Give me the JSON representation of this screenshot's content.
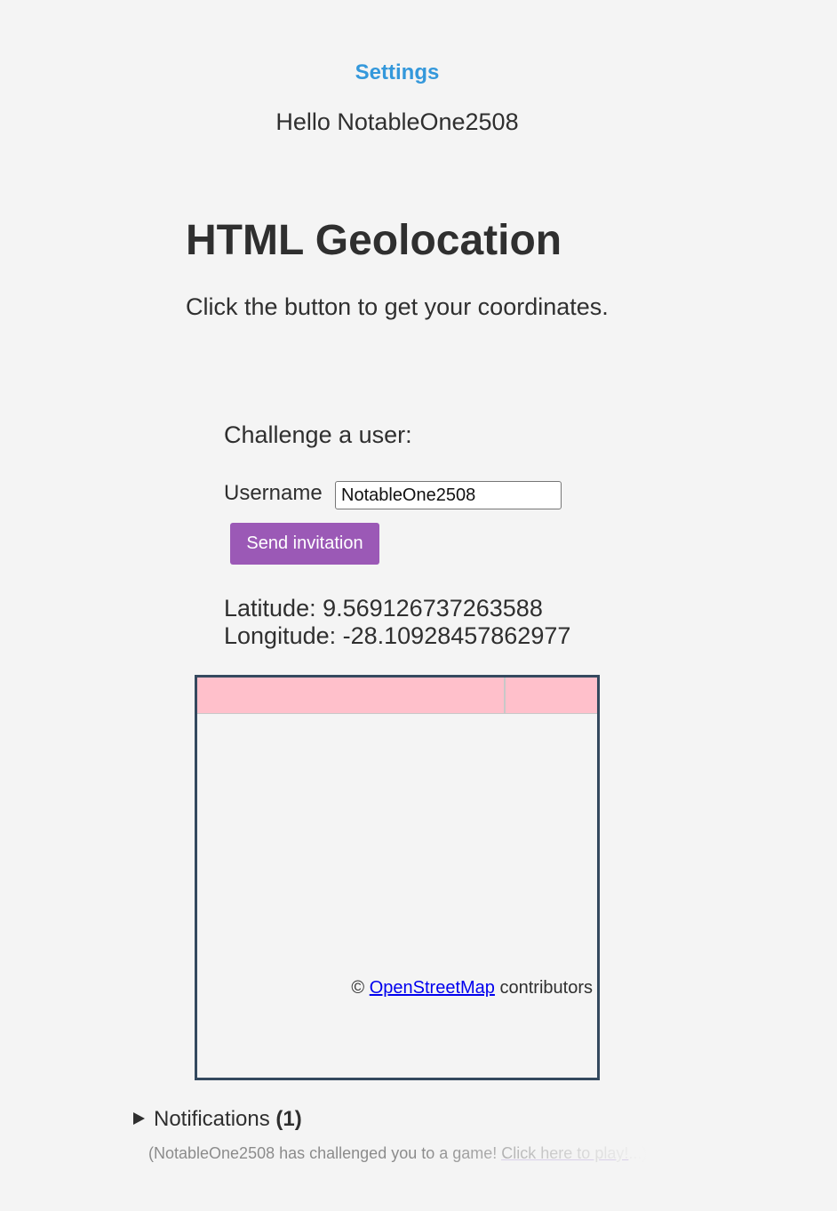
{
  "header": {
    "settings_label": "Settings",
    "greeting": "Hello NotableOne2508"
  },
  "main": {
    "title": "HTML Geolocation",
    "instructions": "Click the button to get your coordinates."
  },
  "challenge": {
    "heading": "Challenge a user:",
    "username_label": "Username",
    "username_value": "NotableOne2508",
    "send_label": "Send invitation"
  },
  "location": {
    "latitude_text": "Latitude: 9.569126737263588",
    "longitude_text": "Longitude: -28.10928457862977"
  },
  "map": {
    "attribution_prefix": "©",
    "attribution_link": "OpenStreetMap",
    "attribution_suffix": "contributors",
    "tile_color": "#ffc0cb"
  },
  "notifications": {
    "label": "Notifications",
    "count": "(1)",
    "items": [
      {
        "text": "(NotableOne2508 has challenged you to a game! ",
        "link": "Click here to play!",
        "ellipsis": "...)"
      }
    ]
  },
  "colors": {
    "accent": "#3498db",
    "button": "#9b59b6",
    "map_border": "#34495e",
    "background": "#f4f4f4"
  }
}
